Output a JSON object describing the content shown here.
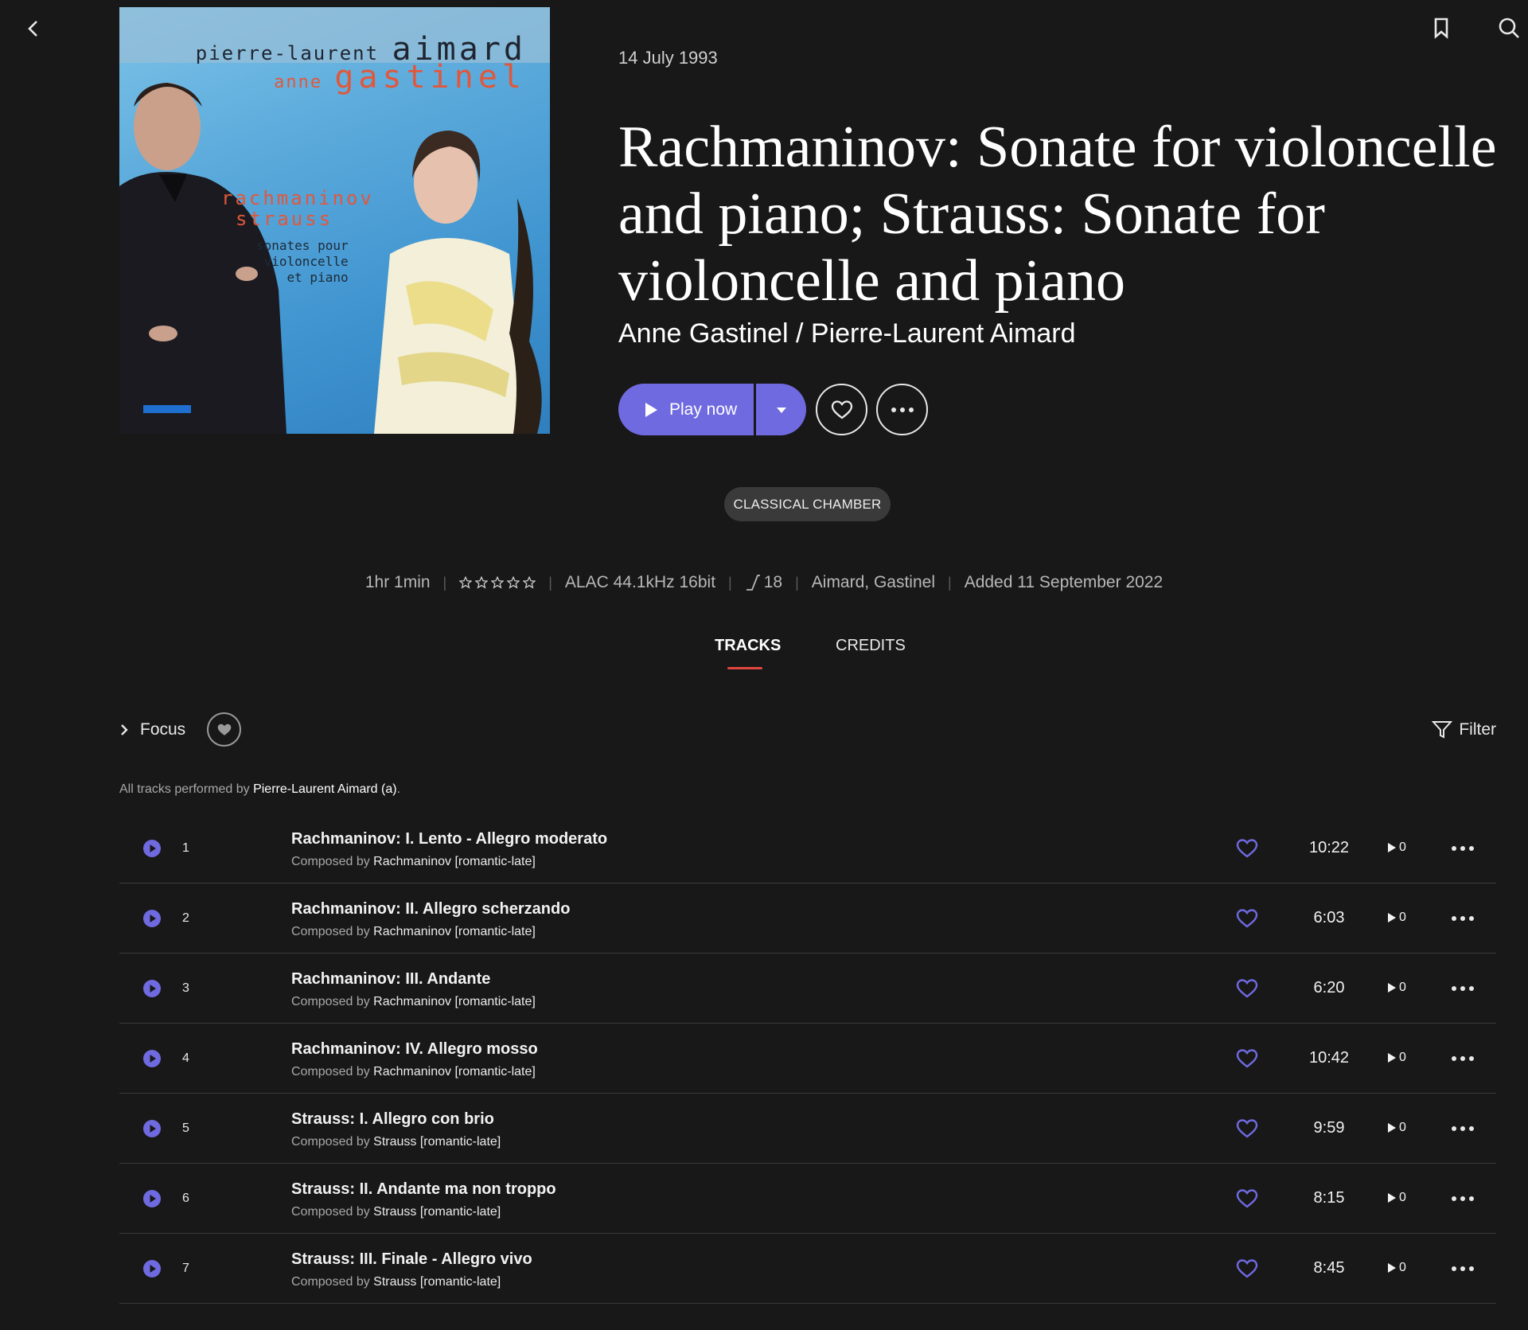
{
  "album": {
    "date": "14 July 1993",
    "title": "Rachmaninov: Sonate for violoncelle and piano; Strauss: Sonate for violoncelle and piano",
    "artists": "Anne Gastinel / Pierre-Laurent Aimard",
    "cover": {
      "line1_small": "pierre-laurent",
      "line1_big": "aimard",
      "line2_small": "anne",
      "line2_big": "gastinel",
      "composer1": "rachmaninov",
      "composer2": "strauss",
      "subtitle1": "sonates pour",
      "subtitle2": "violoncelle",
      "subtitle3": "et piano"
    }
  },
  "actions": {
    "play_label": "Play now"
  },
  "genre": "CLASSICAL CHAMBER",
  "meta": {
    "duration": "1hr 1min",
    "rating": 0,
    "rating_max": 5,
    "format": "ALAC 44.1kHz 16bit",
    "dynamic_range": "18",
    "performers": "Aimard, Gastinel",
    "added": "Added 11 September 2022"
  },
  "tabs": {
    "tracks": "TRACKS",
    "credits": "CREDITS",
    "active": "tracks"
  },
  "toolbar": {
    "focus": "Focus",
    "filter": "Filter"
  },
  "performed": {
    "prefix": "All tracks performed by",
    "name": "Pierre-Laurent Aimard (a)",
    "suffix": "."
  },
  "colors": {
    "accent": "#6f6ae0",
    "background": "#181818",
    "tab_underline": "#e0453f"
  },
  "tracks": [
    {
      "num": "1",
      "title": "Rachmaninov: I. Lento - Allegro moderato",
      "composed_prefix": "Composed by",
      "composer": "Rachmaninov [romantic-late]",
      "duration": "10:22",
      "plays": "0"
    },
    {
      "num": "2",
      "title": "Rachmaninov: II. Allegro scherzando",
      "composed_prefix": "Composed by",
      "composer": "Rachmaninov [romantic-late]",
      "duration": "6:03",
      "plays": "0"
    },
    {
      "num": "3",
      "title": "Rachmaninov: III. Andante",
      "composed_prefix": "Composed by",
      "composer": "Rachmaninov [romantic-late]",
      "duration": "6:20",
      "plays": "0"
    },
    {
      "num": "4",
      "title": "Rachmaninov: IV. Allegro mosso",
      "composed_prefix": "Composed by",
      "composer": "Rachmaninov [romantic-late]",
      "duration": "10:42",
      "plays": "0"
    },
    {
      "num": "5",
      "title": "Strauss: I. Allegro con brio",
      "composed_prefix": "Composed by",
      "composer": "Strauss [romantic-late]",
      "duration": "9:59",
      "plays": "0"
    },
    {
      "num": "6",
      "title": "Strauss: II. Andante ma non troppo",
      "composed_prefix": "Composed by",
      "composer": "Strauss [romantic-late]",
      "duration": "8:15",
      "plays": "0"
    },
    {
      "num": "7",
      "title": "Strauss: III. Finale - Allegro vivo",
      "composed_prefix": "Composed by",
      "composer": "Strauss [romantic-late]",
      "duration": "8:45",
      "plays": "0"
    }
  ]
}
